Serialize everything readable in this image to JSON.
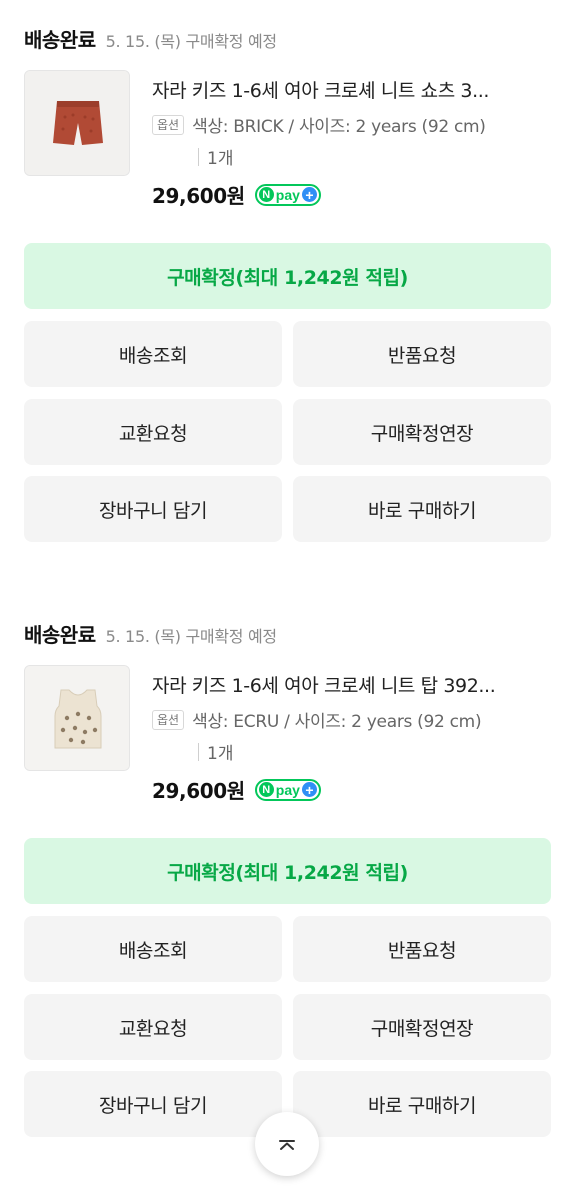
{
  "orders": [
    {
      "status": "배송완료",
      "eta": "5. 15. (목) 구매확정 예정",
      "product_name": "자라 키즈 1-6세 여아 크로셰 니트 쇼츠 3...",
      "option_badge": "옵션",
      "option_text": "색상: BRICK / 사이즈: 2 years (92 cm)",
      "quantity": "1개",
      "price": "29,600원",
      "npay_label": "pay",
      "npay_n": "N",
      "npay_plus": "+",
      "thumbnail_icon": "brick-knit-shorts-image",
      "confirm_label": "구매확정(최대 1,242원 적립)",
      "actions": {
        "tracking": "배송조회",
        "return": "반품요청",
        "exchange": "교환요청",
        "extend": "구매확정연장",
        "cart": "장바구니 담기",
        "buy_now": "바로 구매하기"
      }
    },
    {
      "status": "배송완료",
      "eta": "5. 15. (목) 구매확정 예정",
      "product_name": "자라 키즈 1-6세 여아 크로셰 니트 탑 392...",
      "option_badge": "옵션",
      "option_text": "색상: ECRU / 사이즈: 2 years (92 cm)",
      "quantity": "1개",
      "price": "29,600원",
      "npay_label": "pay",
      "npay_n": "N",
      "npay_plus": "+",
      "thumbnail_icon": "ecru-knit-top-image",
      "confirm_label": "구매확정(최대 1,242원 적립)",
      "actions": {
        "tracking": "배송조회",
        "return": "반품요청",
        "exchange": "교환요청",
        "extend": "구매확정연장",
        "cart": "장바구니 담기",
        "buy_now": "바로 구매하기"
      }
    }
  ],
  "scroll_top_icon": "chevron-up-icon",
  "colors": {
    "accent_green": "#03c75a",
    "confirm_bg": "#d9f8e3",
    "confirm_text": "#07a846",
    "action_bg": "#f4f4f4",
    "npay_plus": "#2f8ff5"
  }
}
